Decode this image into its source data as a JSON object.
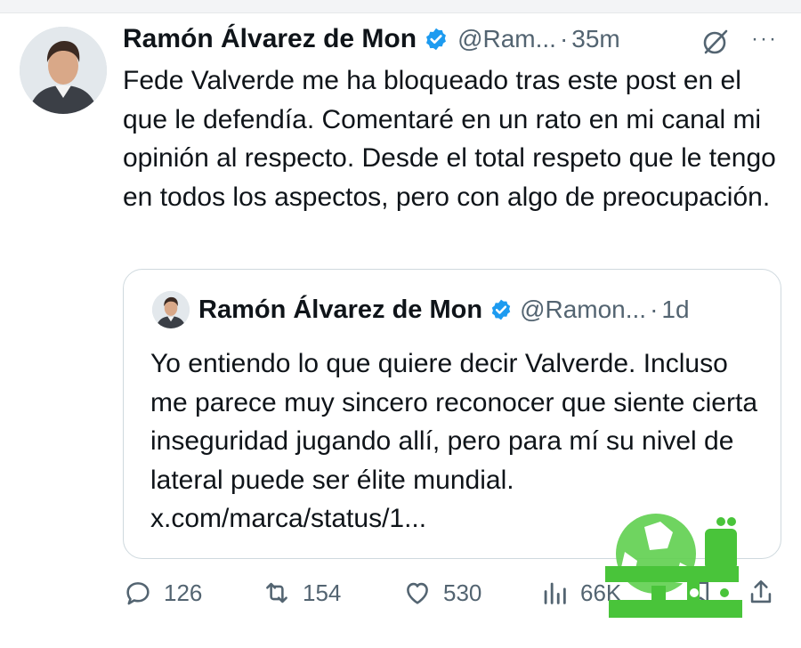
{
  "tweet": {
    "author_name": "Ramón Álvarez de Mon",
    "handle": "@Ram...",
    "separator": "·",
    "time": "35m",
    "more_label": "···",
    "text": "Fede Valverde me ha bloqueado tras este post en el que le defendía. Comentaré en un rato en mi canal mi opinión al respecto. Desde el total respeto que le tengo en todos los aspectos, pero con algo de preocupación."
  },
  "quote": {
    "author_name": "Ramón Álvarez de Mon",
    "handle": "@Ramon...",
    "separator": "·",
    "time": "1d",
    "text": "Yo entiendo lo que quiere decir Valverde. Incluso me parece muy sincero reconocer que siente cierta inseguridad jugando allí, pero para mí su nivel de lateral puede ser élite mundial. x.com/marca/status/1..."
  },
  "actions": {
    "replies": "126",
    "reposts": "154",
    "likes": "530",
    "views": "66K"
  },
  "icons": {
    "verified": "verified-badge-icon",
    "grok": "grok-icon",
    "reply": "reply-icon",
    "repost": "repost-icon",
    "like": "like-icon",
    "views": "views-icon",
    "bookmark": "bookmark-icon",
    "share": "share-icon"
  },
  "colors": {
    "verified_blue": "#1d9bf0",
    "text_secondary": "#536471",
    "border": "#cfd9de",
    "watermark_green": "#49c43a"
  }
}
